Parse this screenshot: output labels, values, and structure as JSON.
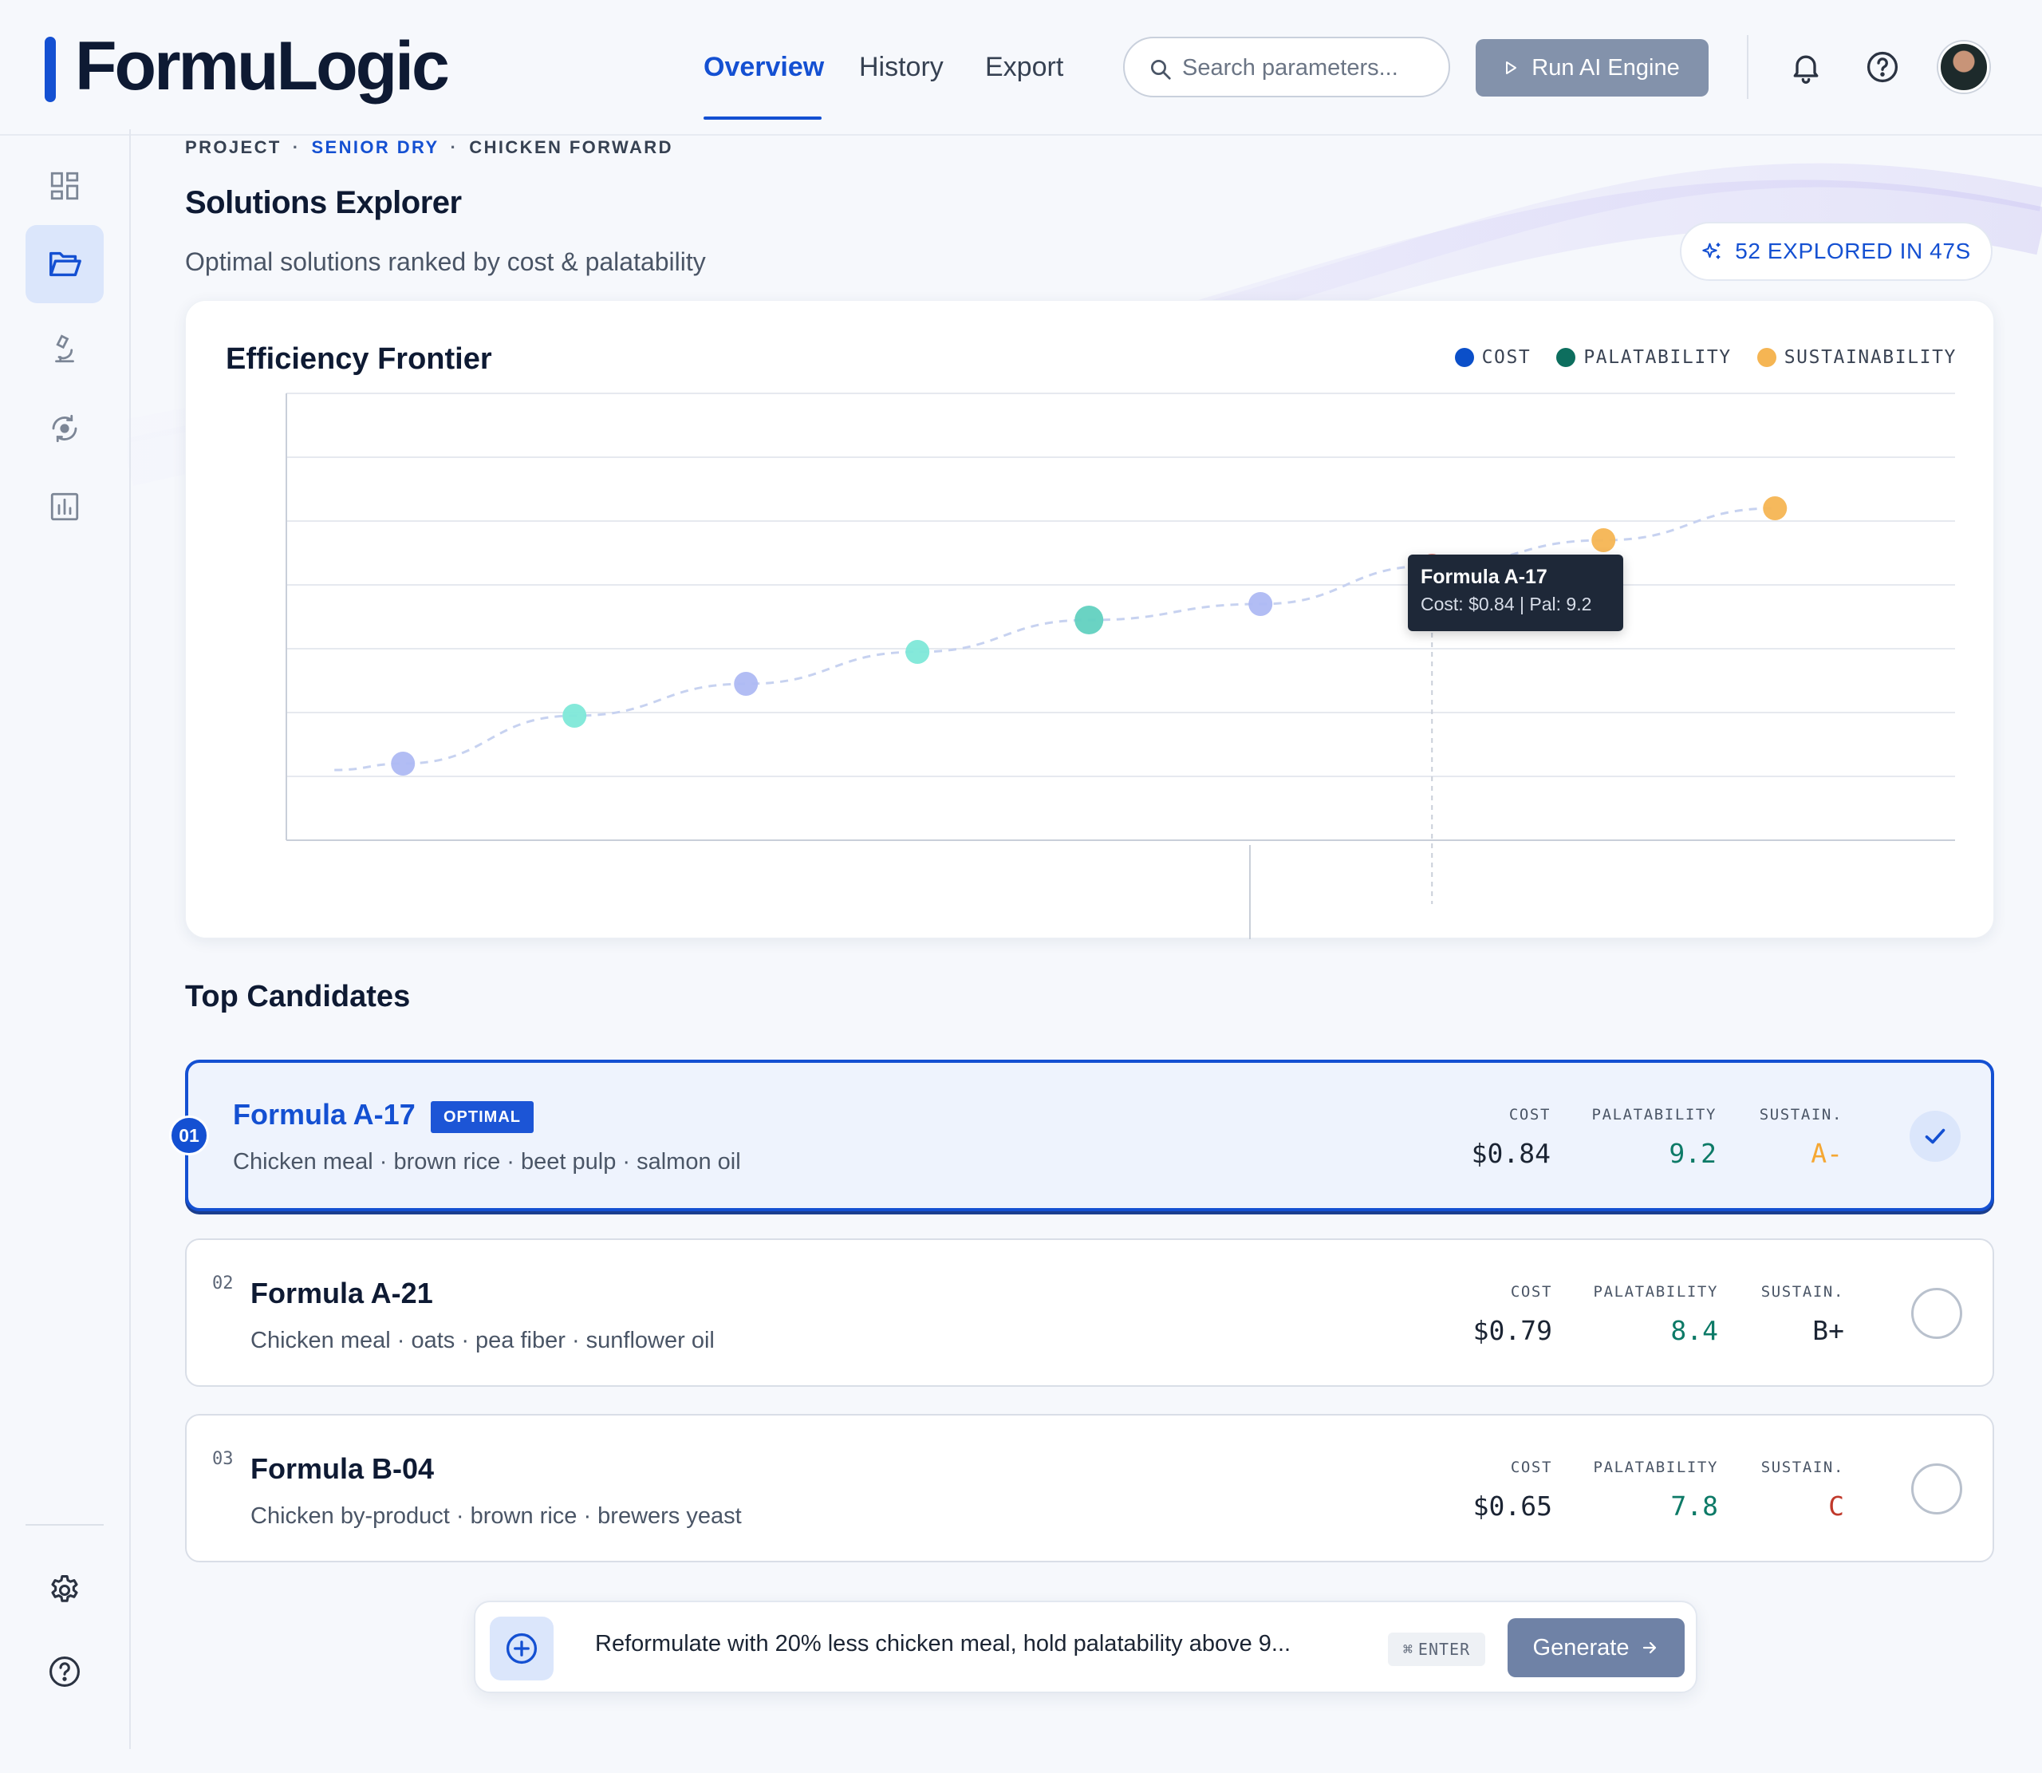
{
  "app": {
    "logo": "FormuLogic",
    "nav": [
      {
        "label": "Overview",
        "active": true
      },
      {
        "label": "History",
        "active": false
      },
      {
        "label": "Export",
        "active": false
      }
    ],
    "search_placeholder": "Search parameters...",
    "run_button": "Run AI Engine",
    "icons": [
      "bell-icon",
      "help-icon",
      "avatar"
    ]
  },
  "sidebar": {
    "items": [
      {
        "icon": "dashboard-icon",
        "active": false
      },
      {
        "icon": "folder-open-icon",
        "active": true
      },
      {
        "icon": "microscope-icon",
        "active": false
      },
      {
        "icon": "ai-cycle-icon",
        "active": false
      },
      {
        "icon": "bar-chart-icon",
        "active": false
      }
    ],
    "bottom": [
      {
        "icon": "gear-icon"
      },
      {
        "icon": "help-icon"
      }
    ]
  },
  "breadcrumb": {
    "project": "PROJECT",
    "line": "SENIOR DRY",
    "recipe": "CHICKEN FORWARD",
    "separator": "·"
  },
  "page": {
    "title": "Solutions Explorer",
    "subtitle": "Optimal solutions ranked by cost & palatability",
    "explored_badge": "52 EXPLORED IN 47S"
  },
  "chart_data": {
    "type": "scatter",
    "title": "Efficiency Frontier",
    "legend": [
      {
        "name": "COST",
        "color": "#0b4fc9"
      },
      {
        "name": "PALATABILITY",
        "color": "#0d6e5e"
      },
      {
        "name": "SUSTAINABILITY",
        "color": "#f5b553"
      }
    ],
    "grid": true,
    "points": [
      {
        "x": 1,
        "y": 1.0,
        "color": "#aeb9f3"
      },
      {
        "x": 2,
        "y": 1.75,
        "color": "#7ee8d8"
      },
      {
        "x": 3,
        "y": 2.25,
        "color": "#aeb9f3"
      },
      {
        "x": 4,
        "y": 2.75,
        "color": "#7ee8d8"
      },
      {
        "x": 5,
        "y": 3.25,
        "color": "#62d1c0"
      },
      {
        "x": 6,
        "y": 3.5,
        "color": "#aeb9f3"
      },
      {
        "x": 7,
        "y": 4.1,
        "color": "#f08a7e"
      },
      {
        "x": 8,
        "y": 4.5,
        "color": "#f5b553"
      },
      {
        "x": 9,
        "y": 5.0,
        "color": "#f5b553"
      }
    ],
    "highlight_index": 6,
    "tooltip": {
      "name": "Formula A-17",
      "detail": "Cost: $0.84 | Pal: 9.2"
    }
  },
  "candidates_title": "Top Candidates",
  "metric_labels": {
    "cost": "COST",
    "pal": "PALATABILITY",
    "sus": "SUSTAIN."
  },
  "candidates": [
    {
      "rank": "01",
      "name": "Formula A-17",
      "badge": "OPTIMAL",
      "ingredients": "Chicken meal · brown rice · beet pulp · salmon oil",
      "cost": "$0.84",
      "palatability": "9.2",
      "sustain": "A-",
      "sustain_color": "#f5a733",
      "selected": true
    },
    {
      "rank": "02",
      "name": "Formula A-21",
      "ingredients": "Chicken meal · oats · pea fiber · sunflower oil",
      "cost": "$0.79",
      "palatability": "8.4",
      "sustain": "B+",
      "sustain_color": "#1b2433",
      "selected": false
    },
    {
      "rank": "03",
      "name": "Formula B-04",
      "ingredients": "Chicken by-product · brown rice · brewers yeast",
      "cost": "$0.65",
      "palatability": "7.8",
      "sustain": "C",
      "sustain_color": "#c0392b",
      "selected": false
    }
  ],
  "prompt": {
    "text": "Reformulate with 20% less chicken meal, hold palatability above 9...",
    "shortcut": "ENTER",
    "shortcut_symbol": "⌘",
    "button": "Generate"
  }
}
